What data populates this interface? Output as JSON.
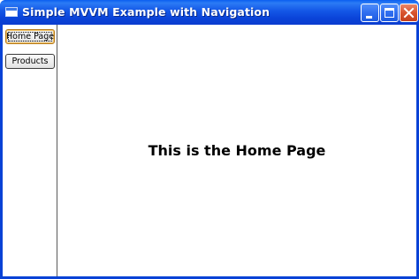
{
  "window": {
    "title": "Simple MVVM Example with Navigation",
    "icons": [
      "app-icon",
      "minimize-icon",
      "maximize-icon",
      "close-icon"
    ]
  },
  "sidebar": {
    "buttons": [
      {
        "label": "Home Page",
        "focused": true
      },
      {
        "label": "Products",
        "focused": false
      }
    ]
  },
  "content": {
    "heading": "This is the Home Page"
  },
  "colors": {
    "title_bar": "#0a43d8",
    "close_button": "#d8532e",
    "focus_border": "#f2c264"
  }
}
